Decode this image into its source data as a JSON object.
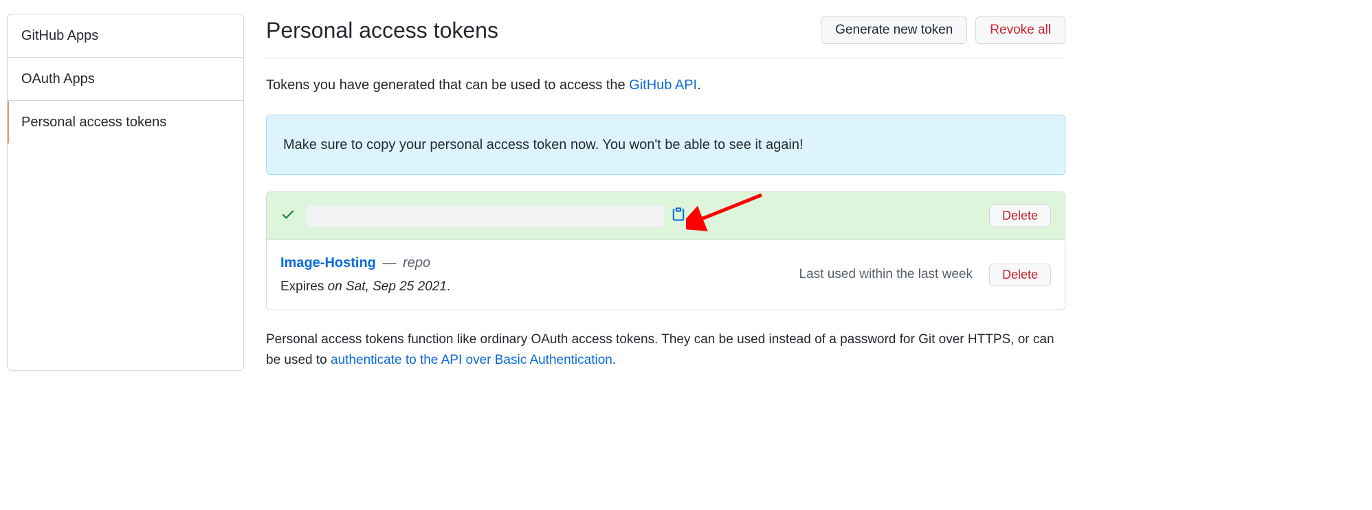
{
  "sidebar": {
    "items": [
      {
        "label": "GitHub Apps"
      },
      {
        "label": "OAuth Apps"
      },
      {
        "label": "Personal access tokens"
      }
    ]
  },
  "header": {
    "title": "Personal access tokens",
    "generate_label": "Generate new token",
    "revoke_label": "Revoke all"
  },
  "description": {
    "prefix": "Tokens you have generated that can be used to access the ",
    "link_text": "GitHub API",
    "suffix": "."
  },
  "flash": {
    "message": "Make sure to copy your personal access token now. You won't be able to see it again!"
  },
  "tokens": {
    "new": {
      "delete_label": "Delete"
    },
    "existing": {
      "name": "Image-Hosting",
      "separator": "—",
      "scope": "repo",
      "expires_prefix": "Expires ",
      "expires_date": "on Sat, Sep 25 2021",
      "expires_suffix": ".",
      "last_used": "Last used within the last week",
      "delete_label": "Delete"
    }
  },
  "footer": {
    "text1": "Personal access tokens function like ordinary OAuth access tokens. They can be used instead of a password for Git over HTTPS, or can be used to ",
    "link_text": "authenticate to the API over Basic Authentication",
    "suffix": "."
  }
}
